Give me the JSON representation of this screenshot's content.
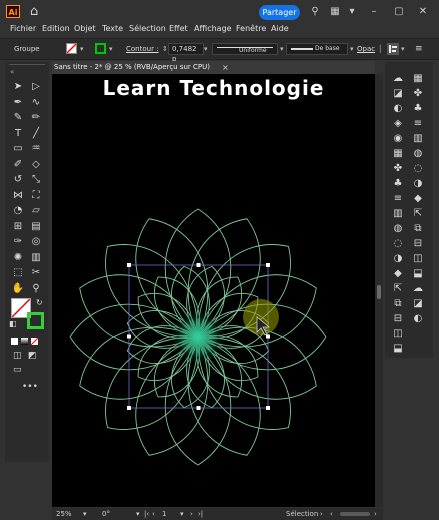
{
  "app": {
    "logo": "Ai",
    "share_label": "Partager"
  },
  "menu": [
    "Fichier",
    "Edition",
    "Objet",
    "Texte",
    "Sélection",
    "Effet",
    "Affichage",
    "Fenêtre",
    "Aide"
  ],
  "control_bar": {
    "selection_type": "Groupe",
    "stroke_label": "Contour :",
    "stroke_weight": "0,7482 p",
    "profile": "Uniforme",
    "brush": "De base",
    "opacity_label": "Opac",
    "stroke_color": "#00c800"
  },
  "document": {
    "tab_title": "Sans titre - 2* @ 25 % (RVB/Aperçu sur CPU)",
    "close_glyph": "×",
    "overlay_title": "Learn  Technologie"
  },
  "status_bar": {
    "zoom": "25%",
    "rotation": "0°",
    "artboard": "1",
    "tool": "Sélection"
  },
  "colors": {
    "accent": "#1473e6",
    "flower_stroke": "#7fc89a",
    "center_glow": "#1fd8a0",
    "fill_swatch": "#ffffff",
    "stroke_swatch": "#32d232"
  },
  "tool_icons": [
    "selection-icon",
    "direct-selection-icon",
    "pen-icon",
    "curvature-icon",
    "brush-icon",
    "pencil-icon",
    "type-icon",
    "line-icon",
    "rectangle-icon",
    "paintbrush-icon",
    "shaper-icon",
    "eraser-icon",
    "rotate-icon",
    "scale-icon",
    "width-icon",
    "free-transform-icon",
    "shape-builder-icon",
    "perspective-icon",
    "mesh-icon",
    "gradient-icon",
    "eyedropper-icon",
    "blend-icon",
    "symbol-sprayer-icon",
    "graph-icon",
    "artboard-icon",
    "slice-icon",
    "hand-icon",
    "zoom-icon"
  ],
  "right_icons": [
    "libraries-icon",
    "properties-icon",
    "layers-icon",
    "color-icon",
    "color-guide-icon",
    "swatches-icon",
    "brushes-icon",
    "symbols-icon",
    "stroke-icon",
    "gradient-panel-icon",
    "transparency-icon",
    "appearance-icon",
    "graphic-styles-icon",
    "layers-stack-icon",
    "export-icon",
    "artboards-icon",
    "align-icon",
    "pathfinder-icon",
    "transform-icon"
  ]
}
